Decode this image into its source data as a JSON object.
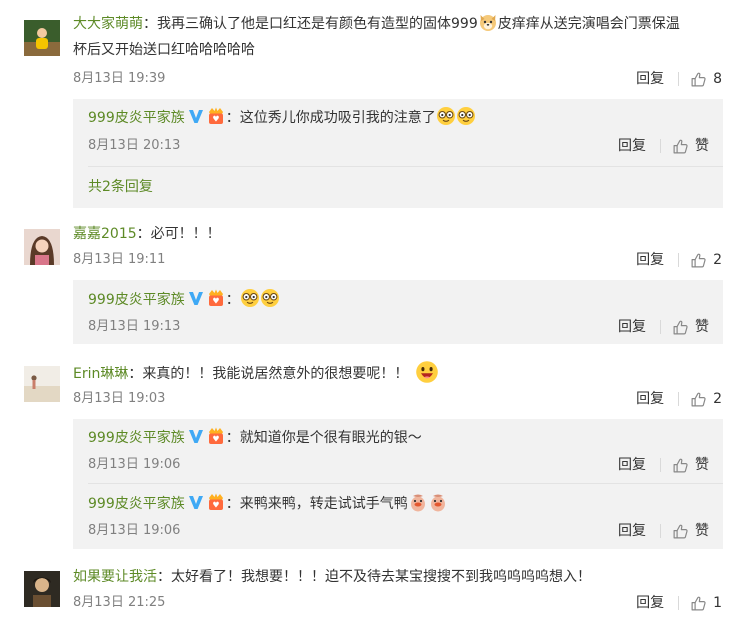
{
  "comments": [
    {
      "user": "大大家萌萌",
      "text_line1": "我再三确认了他是口红还是有颜色有造型的固体999",
      "text_line1b": "皮痒痒从送完演唱会门票保温",
      "text_line2": "杯后又开始送口红哈哈哈哈哈",
      "time": "8月13日 19:39",
      "reply_label": "回复",
      "likes": "8",
      "replies": [
        {
          "user": "999皮炎平家族",
          "text": "这位秀儿你成功吸引我的注意了",
          "time": "8月13日 20:13",
          "reply_label": "回复",
          "like_label": "赞"
        }
      ],
      "more_replies": "共2条回复"
    },
    {
      "user": "嘉嘉2015",
      "text": "必可！！！",
      "time": "8月13日 19:11",
      "reply_label": "回复",
      "likes": "2",
      "replies": [
        {
          "user": "999皮炎平家族",
          "text": "",
          "time": "8月13日 19:13",
          "reply_label": "回复",
          "like_label": "赞"
        }
      ]
    },
    {
      "user": "Erin琳琳",
      "text": "来真的！！我能说居然意外的很想要呢！！",
      "time": "8月13日 19:03",
      "reply_label": "回复",
      "likes": "2",
      "replies": [
        {
          "user": "999皮炎平家族",
          "text": "就知道你是个很有眼光的银～",
          "time": "8月13日 19:06",
          "reply_label": "回复",
          "like_label": "赞"
        },
        {
          "user": "999皮炎平家族",
          "text": "来鸭来鸭，转走试试手气鸭",
          "time": "8月13日 19:06",
          "reply_label": "回复",
          "like_label": "赞"
        }
      ]
    },
    {
      "user": "如果要让我活",
      "text": "太好看了！我想要！！！迫不及待去某宝搜搜不到我呜呜呜呜想入！",
      "time": "8月13日 21:25",
      "reply_label": "回复",
      "likes": "1"
    }
  ],
  "colon": "：",
  "colors": {
    "username": "#5d8a26",
    "sub_bg": "#f2f2f2",
    "time": "#808080",
    "verified_blue": "#3fa9f5"
  },
  "icons": [
    "verified-v-icon",
    "fan-badge-icon",
    "thumbs-up-icon",
    "dog-emoji",
    "sunglasses-emoji",
    "grin-emoji",
    "duck-emoji"
  ]
}
